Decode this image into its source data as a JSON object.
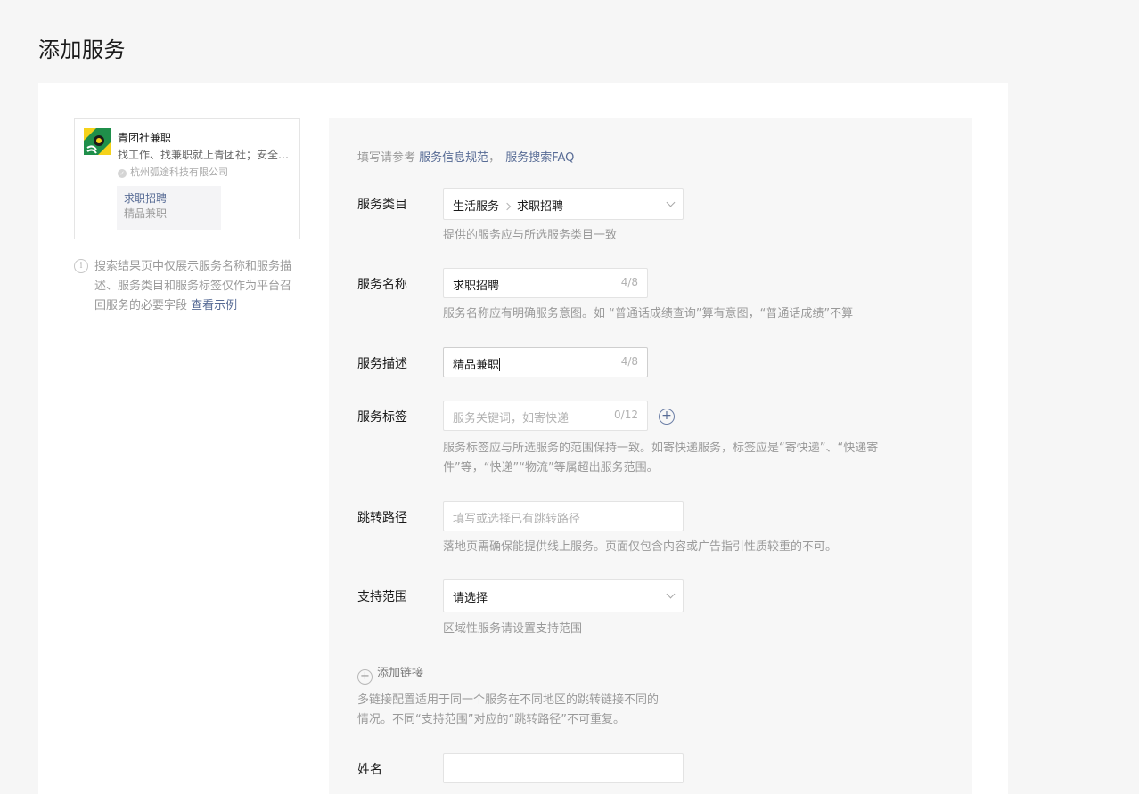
{
  "page": {
    "title": "添加服务"
  },
  "preview": {
    "name": "青团社兼职",
    "desc": "找工作、找兼职就上青团社；安全靠谱，海量兼职任你选",
    "company": "杭州弧途科技有限公司",
    "tag_name": "求职招聘",
    "tag_desc": "精品兼职"
  },
  "tip": {
    "text": "搜索结果页中仅展示服务名称和服务描述、服务类目和服务标签仅作为平台召回服务的必要字段",
    "link": "查看示例"
  },
  "reference": {
    "prefix": "填写请参考",
    "link1": "服务信息规范",
    "sep": "，",
    "link2": "服务搜索FAQ"
  },
  "form": {
    "category": {
      "label": "服务类目",
      "level1": "生活服务",
      "level2": "求职招聘",
      "hint": "提供的服务应与所选服务类目一致"
    },
    "name": {
      "label": "服务名称",
      "value": "求职招聘",
      "counter": "4/8",
      "hint": "服务名称应有明确服务意图。如 “普通话成绩查询”算有意图，“普通话成绩”不算"
    },
    "desc": {
      "label": "服务描述",
      "value": "精品兼职",
      "counter": "4/8"
    },
    "tags": {
      "label": "服务标签",
      "placeholder": "服务关键词，如寄快递",
      "counter": "0/12",
      "hint_line1": "服务标签应与所选服务的范围保持一致。如寄快递服务，标签应是“寄快递”、“快递寄",
      "hint_line2": "件”等，“快递”“物流”等属超出服务范围。"
    },
    "path": {
      "label": "跳转路径",
      "placeholder": "填写或选择已有跳转路径",
      "hint": "落地页需确保能提供线上服务。页面仅包含内容或广告指引性质较重的不可。"
    },
    "scope": {
      "label": "支持范围",
      "value": "请选择",
      "hint": "区域性服务请设置支持范围"
    },
    "add_link": {
      "label": "添加链接",
      "hint_line1": "多链接配置适用于同一个服务在不同地区的跳转链接不同的",
      "hint_line2": "情况。不同“支持范围”对应的“跳转路径”不可重复。"
    },
    "fullname": {
      "label": "姓名",
      "value": ""
    }
  }
}
